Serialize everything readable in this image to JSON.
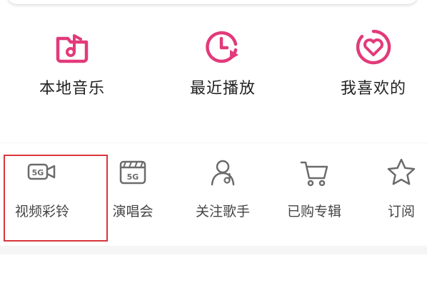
{
  "colors": {
    "accent": "#e23a7a",
    "icon_gray": "#6b6b6b",
    "highlight": "#d9353a"
  },
  "quick_access": [
    {
      "label": "本地音乐",
      "icon": "music-folder-icon"
    },
    {
      "label": "最近播放",
      "icon": "clock-play-icon"
    },
    {
      "label": "我喜欢的",
      "icon": "heart-circle-icon"
    }
  ],
  "services": [
    {
      "label": "视频彩铃",
      "icon": "5g-video-camera-icon",
      "badge": "5G"
    },
    {
      "label": "演唱会",
      "icon": "5g-concert-icon",
      "badge": "5G"
    },
    {
      "label": "关注歌手",
      "icon": "singer-person-icon"
    },
    {
      "label": "已购专辑",
      "icon": "shopping-cart-icon"
    },
    {
      "label": "订阅",
      "icon": "star-icon"
    }
  ]
}
